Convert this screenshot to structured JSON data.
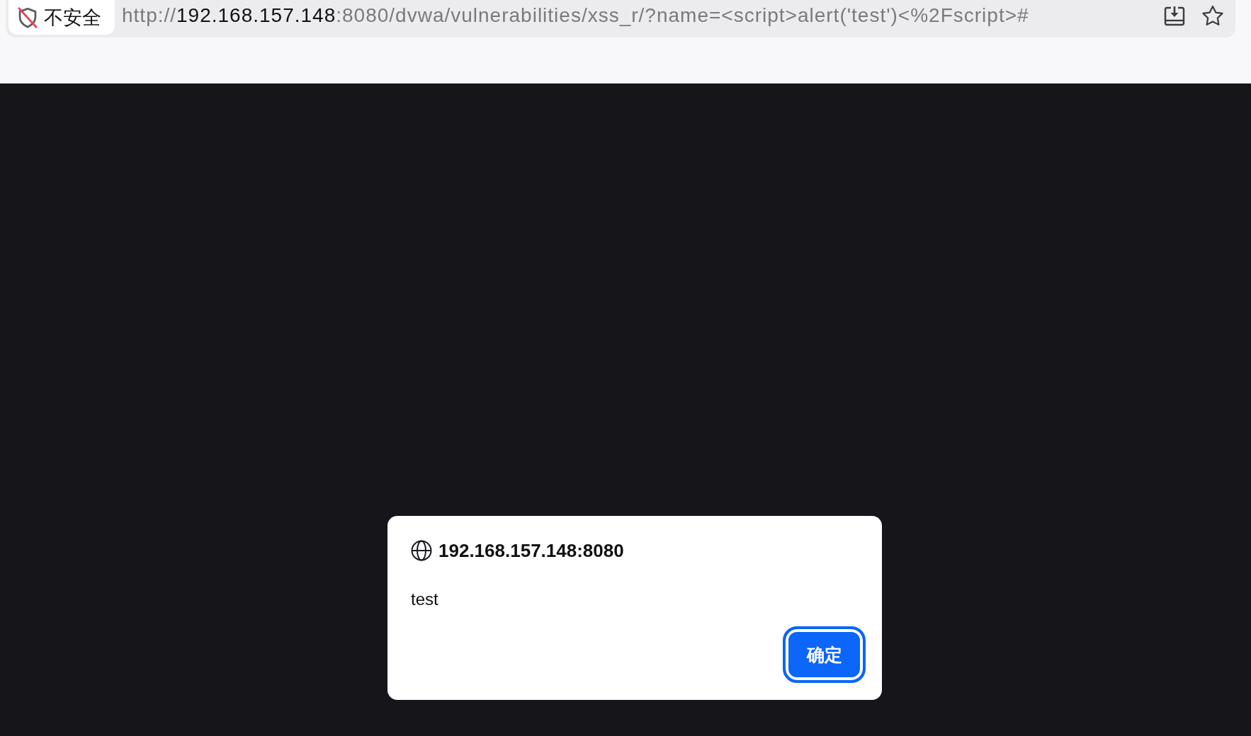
{
  "address_bar": {
    "security_label": "不安全",
    "url": {
      "scheme": "http://",
      "host": "192.168.157.148",
      "rest": ":8080/dvwa/vulnerabilities/xss_r/?name=<script>alert('test')<%2Fscript>#"
    }
  },
  "dialog": {
    "origin": "192.168.157.148:8080",
    "message": "test",
    "buttons": [
      {
        "label": "确定",
        "focused": true
      }
    ]
  }
}
